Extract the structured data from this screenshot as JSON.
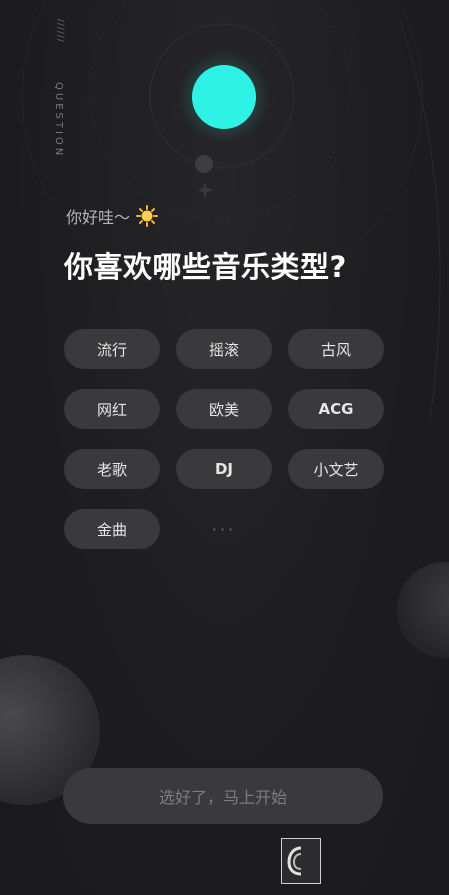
{
  "side_label": {
    "slashes": "//////",
    "text": "QUESTION"
  },
  "greeting": {
    "text": "你好哇～",
    "icon": "sun-emoji-icon"
  },
  "title": "你喜欢哪些音乐类型?",
  "tags": [
    {
      "label": "流行",
      "bold": false
    },
    {
      "label": "摇滚",
      "bold": false
    },
    {
      "label": "古风",
      "bold": false
    },
    {
      "label": "网红",
      "bold": false
    },
    {
      "label": "欧美",
      "bold": false
    },
    {
      "label": "ACG",
      "bold": true
    },
    {
      "label": "老歌",
      "bold": false
    },
    {
      "label": "DJ",
      "bold": true
    },
    {
      "label": "小文艺",
      "bold": false
    },
    {
      "label": "金曲",
      "bold": false
    }
  ],
  "more_indicator": "···",
  "start_button": {
    "label": "选好了，马上开始"
  },
  "watermark": {
    "text": " "
  },
  "colors": {
    "background": "#1f1f21",
    "accent_orb": "#2ef2e6",
    "tag_bg": "#3a3a3c",
    "tag_text": "#e6e6e6",
    "title": "#ffffff",
    "button_text": "#7d7d80"
  }
}
